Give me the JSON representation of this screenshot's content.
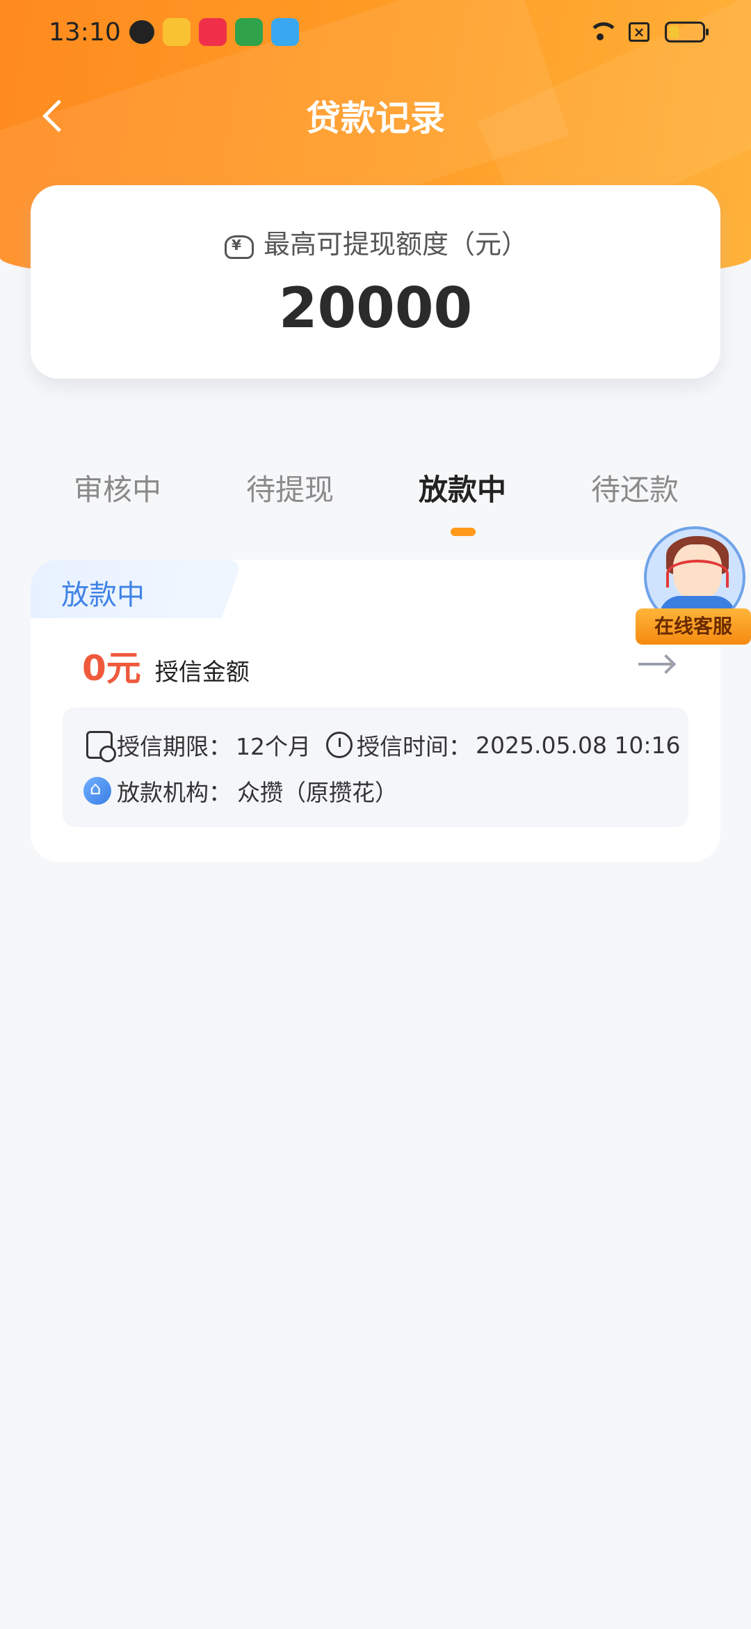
{
  "status_bar": {
    "time": "13:10",
    "notification_icons": [
      "wechat-icon",
      "store-icon",
      "music-icon",
      "game-icon",
      "plane-icon"
    ],
    "system_icons": [
      "wifi-icon",
      "sim-icon",
      "battery-icon"
    ]
  },
  "header": {
    "title": "贷款记录"
  },
  "quota": {
    "label": "最高可提现额度（元）",
    "amount": "20000"
  },
  "tabs": [
    {
      "label": "审核中",
      "active": false
    },
    {
      "label": "待提现",
      "active": false
    },
    {
      "label": "放款中",
      "active": true
    },
    {
      "label": "待还款",
      "active": false
    }
  ],
  "record": {
    "status": "放款中",
    "amount_value": "0元",
    "amount_label": "授信金额",
    "term_label": "授信期限：",
    "term_value": "12个月",
    "time_label": "授信时间：",
    "time_value": "2025.05.08 10:16",
    "institution_label": "放款机构：",
    "institution_value": "众攒（原攒花）"
  },
  "service": {
    "label": "在线客服"
  },
  "colors": {
    "brand_orange": "#ff9a24",
    "amount_red": "#ef5a3c",
    "status_blue": "#3f83e6",
    "tab_indicator": "#ff9a1a"
  }
}
